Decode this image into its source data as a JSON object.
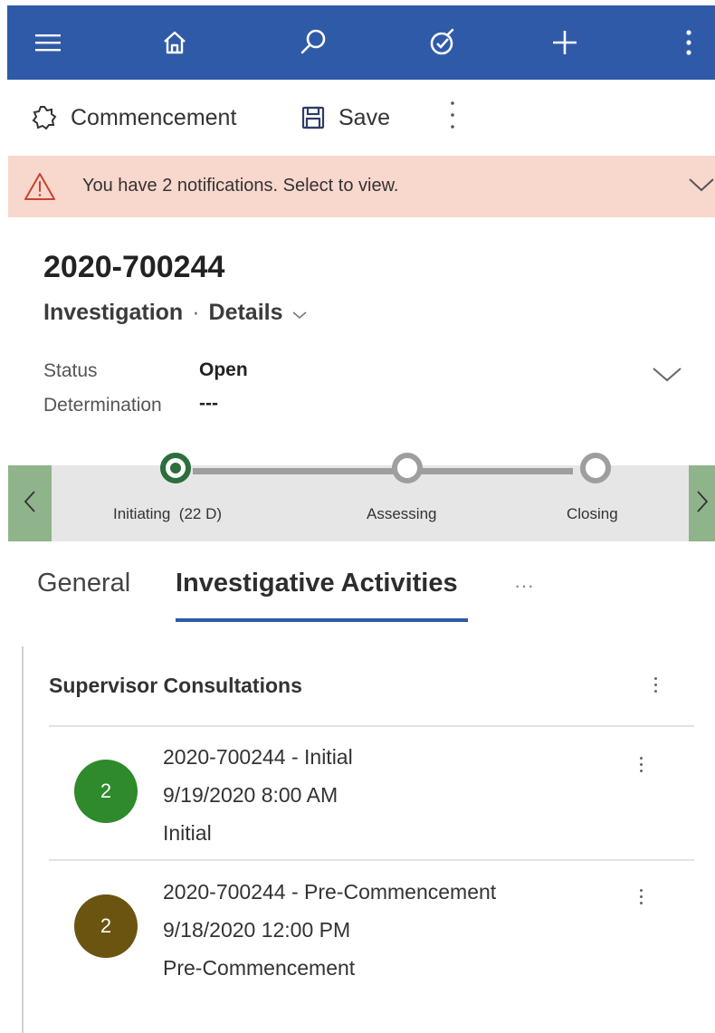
{
  "colors": {
    "nav_bar": "#2f5aa8",
    "notification_bg": "#f8d7cd",
    "bpf_active": "#2c6e3c",
    "bpf_nav": "#8fb48b",
    "avatar_green": "#2e8a2a",
    "avatar_olive": "#6b5410"
  },
  "navbar": {
    "icons": [
      "hamburger-icon",
      "home-icon",
      "search-icon",
      "assistant-icon",
      "plus-icon",
      "more-vertical-icon"
    ]
  },
  "commandbar": {
    "process_label": "Commencement",
    "save_label": "Save"
  },
  "notification": {
    "message": "You have 2 notifications. Select to view."
  },
  "record": {
    "title": "2020-700244",
    "entity": "Investigation",
    "separator": "·",
    "form": "Details"
  },
  "header_fields": [
    {
      "label": "Status",
      "value": "Open"
    },
    {
      "label": "Determination",
      "value": "---"
    }
  ],
  "bpf": {
    "stages": [
      {
        "name": "Initiating",
        "duration": "(22 D)",
        "active": true
      },
      {
        "name": "Assessing",
        "duration": "",
        "active": false
      },
      {
        "name": "Closing",
        "duration": "",
        "active": false
      }
    ]
  },
  "tabs": {
    "items": [
      "General",
      "Investigative Activities"
    ],
    "active": 1,
    "overflow": "···"
  },
  "section": {
    "title": "Supervisor Consultations",
    "records": [
      {
        "avatar": "2",
        "avatar_color": "#2e8a2a",
        "title": "2020-700244 - Initial",
        "date": "9/19/2020 8:00 AM",
        "type": "Initial"
      },
      {
        "avatar": "2",
        "avatar_color": "#6b5410",
        "title": "2020-700244 - Pre-Commencement",
        "date": "9/18/2020 12:00 PM",
        "type": "Pre-Commencement"
      }
    ]
  }
}
